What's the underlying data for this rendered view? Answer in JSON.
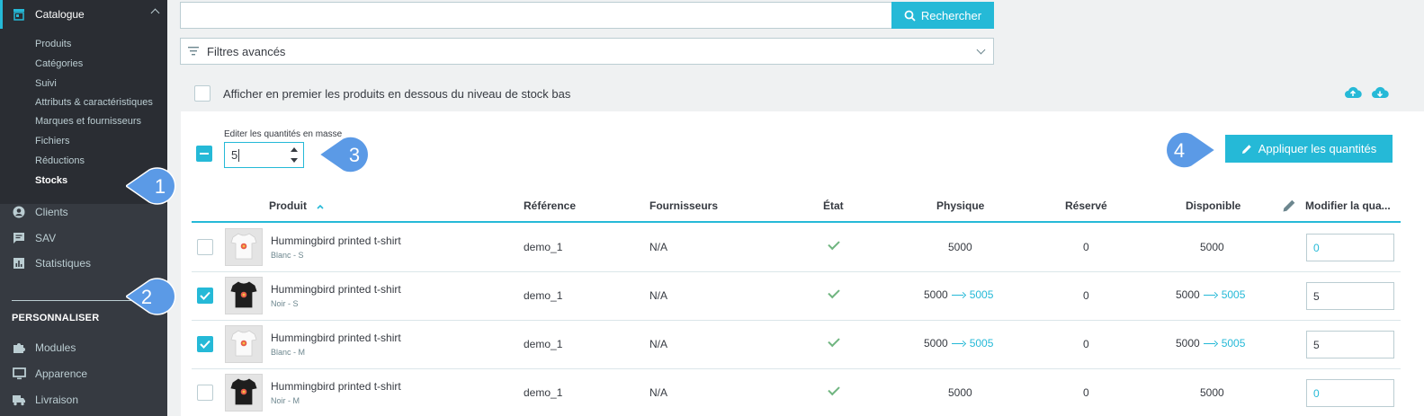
{
  "sidebar": {
    "catalogue_label": "Catalogue",
    "sub_items": [
      "Produits",
      "Catégories",
      "Suivi",
      "Attributs & caractéristiques",
      "Marques et fournisseurs",
      "Fichiers",
      "Réductions",
      "Stocks"
    ],
    "active_sub": "Stocks",
    "items_a": [
      {
        "label": "Clients",
        "icon": "user-icon"
      },
      {
        "label": "SAV",
        "icon": "chat-icon"
      },
      {
        "label": "Statistiques",
        "icon": "chart-icon"
      }
    ],
    "section_heading": "PERSONNALISER",
    "items_b": [
      {
        "label": "Modules",
        "icon": "puzzle-icon"
      },
      {
        "label": "Apparence",
        "icon": "monitor-icon"
      },
      {
        "label": "Livraison",
        "icon": "truck-icon"
      }
    ]
  },
  "callouts": [
    "1",
    "2",
    "3",
    "4"
  ],
  "search": {
    "button_label": "Rechercher",
    "value": ""
  },
  "filters": {
    "label": "Filtres avancés"
  },
  "low_stock": {
    "label": "Afficher en premier les produits en dessous du niveau de stock bas"
  },
  "bulk": {
    "label": "Editer les quantités en masse",
    "value": "5",
    "apply_label": "Appliquer les quantités"
  },
  "table": {
    "headers": {
      "product": "Produit",
      "reference": "Référence",
      "suppliers": "Fournisseurs",
      "state": "État",
      "physical": "Physique",
      "reserved": "Réservé",
      "available": "Disponible",
      "modify": "Modifier la qua..."
    },
    "rows": [
      {
        "name": "Hummingbird printed t-shirt",
        "variant": "Blanc - S",
        "reference": "demo_1",
        "supplier": "N/A",
        "physical": "5000",
        "physical_new": "",
        "reserved": "0",
        "available": "5000",
        "available_new": "",
        "qty": "0",
        "checked": false,
        "shirt": "white"
      },
      {
        "name": "Hummingbird printed t-shirt",
        "variant": "Noir - S",
        "reference": "demo_1",
        "supplier": "N/A",
        "physical": "5000",
        "physical_new": "5005",
        "reserved": "0",
        "available": "5000",
        "available_new": "5005",
        "qty": "5",
        "checked": true,
        "shirt": "black"
      },
      {
        "name": "Hummingbird printed t-shirt",
        "variant": "Blanc - M",
        "reference": "demo_1",
        "supplier": "N/A",
        "physical": "5000",
        "physical_new": "5005",
        "reserved": "0",
        "available": "5000",
        "available_new": "5005",
        "qty": "5",
        "checked": true,
        "shirt": "white"
      },
      {
        "name": "Hummingbird printed t-shirt",
        "variant": "Noir - M",
        "reference": "demo_1",
        "supplier": "N/A",
        "physical": "5000",
        "physical_new": "",
        "reserved": "0",
        "available": "5000",
        "available_new": "",
        "qty": "0",
        "checked": false,
        "shirt": "black"
      }
    ]
  },
  "colors": {
    "accent": "#25b9d7",
    "sidebar": "#363a41",
    "callout": "#5b9ae6",
    "success": "#70b580"
  }
}
